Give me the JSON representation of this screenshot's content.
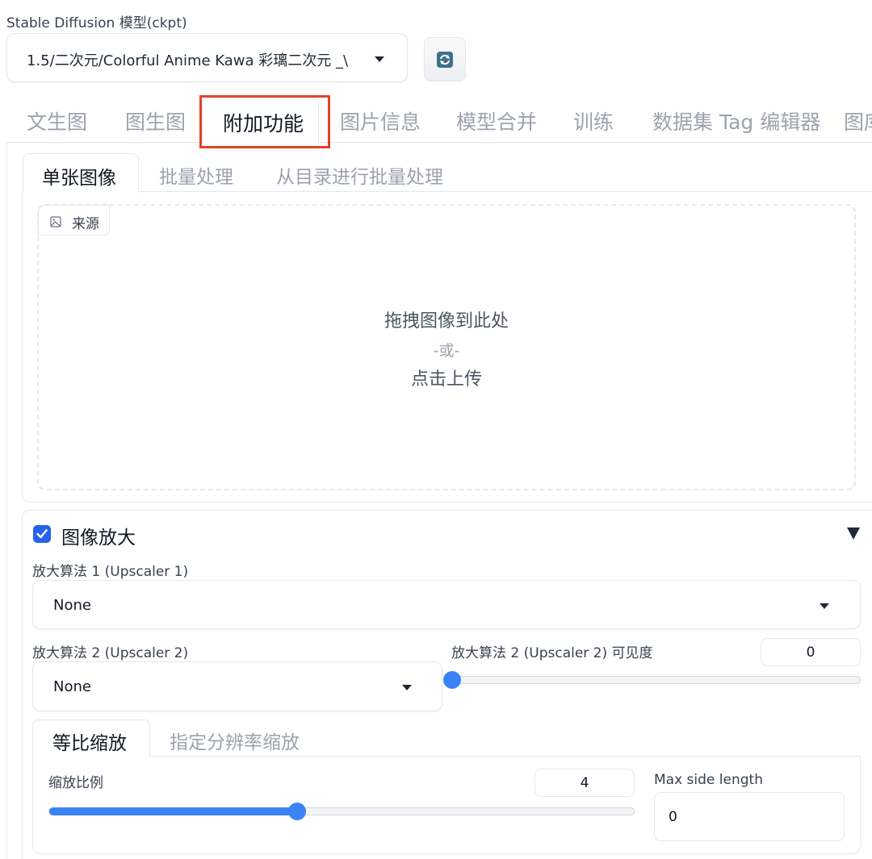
{
  "model": {
    "label": "Stable Diffusion 模型(ckpt)",
    "selected": "1.5/二次元/Colorful Anime Kawa 彩璃二次元 _\\",
    "refresh_icon": "refresh-icon"
  },
  "tabs": {
    "items": [
      "文生图",
      "图生图",
      "附加功能",
      "图片信息",
      "模型合并",
      "训练",
      "数据集 Tag 编辑器",
      "图库"
    ],
    "active": "附加功能"
  },
  "subtabs": {
    "items": [
      "单张图像",
      "批量处理",
      "从目录进行批量处理"
    ],
    "active": "单张图像"
  },
  "source": {
    "label": "来源",
    "icon": "image-icon",
    "drop_text": "拖拽图像到此处",
    "or_text": "-或-",
    "upload_text": "点击上传"
  },
  "upscale": {
    "enabled": true,
    "title": "图像放大",
    "upscaler1_label": "放大算法 1 (Upscaler 1)",
    "upscaler1_value": "None",
    "upscaler2_label": "放大算法 2 (Upscaler 2)",
    "upscaler2_value": "None",
    "visibility_label": "放大算法 2 (Upscaler 2) 可见度",
    "visibility_value": "0",
    "visibility_fraction": 0,
    "scale_tabs": [
      "等比缩放",
      "指定分辨率缩放"
    ],
    "scale_tab_active": "等比缩放",
    "ratio_label": "缩放比例",
    "ratio_value": "4",
    "ratio_fraction": 0.4235,
    "max_side_label": "Max side length",
    "max_side_value": "0"
  },
  "colors": {
    "accent": "#3b82f6",
    "highlight_box": "#e2432d",
    "checkbox": "#2563eb"
  }
}
